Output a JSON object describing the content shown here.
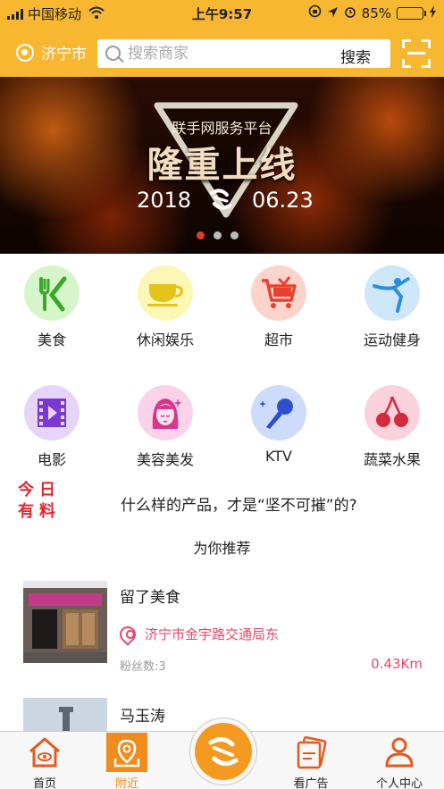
{
  "status_bar": {
    "carrier": "中国移动",
    "time": "上午9:57",
    "battery": "85%",
    "battery_level": 0.85
  },
  "header": {
    "city": "济宁市",
    "search_placeholder": "搜索商家",
    "search_button": "搜索"
  },
  "banner": {
    "subtitle": "联手网服务平台",
    "title": "隆重上线",
    "year": "2018",
    "date": "06.23",
    "page_count": 3,
    "active_page": 1
  },
  "categories": [
    {
      "label": "美食",
      "icon": "fork-knife-icon",
      "bg": "#d6f5c8"
    },
    {
      "label": "休闲娱乐",
      "icon": "teacup-icon",
      "bg": "#fbf7b5"
    },
    {
      "label": "超市",
      "icon": "shopping-cart-icon",
      "bg": "#fcd4cc"
    },
    {
      "label": "运动健身",
      "icon": "yoga-icon",
      "bg": "#cfe7fb"
    },
    {
      "label": "电影",
      "icon": "film-icon",
      "bg": "#e6d4f9"
    },
    {
      "label": "美容美发",
      "icon": "woman-face-icon",
      "bg": "#fad2ea"
    },
    {
      "label": "KTV",
      "icon": "microphone-icon",
      "bg": "#cddcfa"
    },
    {
      "label": "蔬菜水果",
      "icon": "cherry-icon",
      "bg": "#fad2dc"
    }
  ],
  "today": {
    "logo_line1": "今日",
    "logo_line2": "有料",
    "headline": "什么样的产品，才是“坚不可摧”的?"
  },
  "recommend": {
    "title": "为你推荐",
    "merchants": [
      {
        "name": "留了美食",
        "address": "济宁市金宇路交通局东",
        "fans": "粉丝数:3",
        "distance": "0.43Km"
      },
      {
        "name": "马玉涛"
      }
    ]
  },
  "tabbar": {
    "items": [
      {
        "label": "首页",
        "icon": "home-icon"
      },
      {
        "label": "附近",
        "icon": "map-pin-icon",
        "active": true
      },
      {
        "label": "看广告",
        "icon": "ad-cards-icon"
      },
      {
        "label": "个人中心",
        "icon": "user-icon"
      }
    ],
    "center_icon": "app-logo-icon",
    "active_color": "#f08c1e"
  },
  "colors": {
    "brand": "#f7b731",
    "accent_red": "#e8232b",
    "address_pink": "#e8466a",
    "tab_orange": "#f59a21"
  }
}
